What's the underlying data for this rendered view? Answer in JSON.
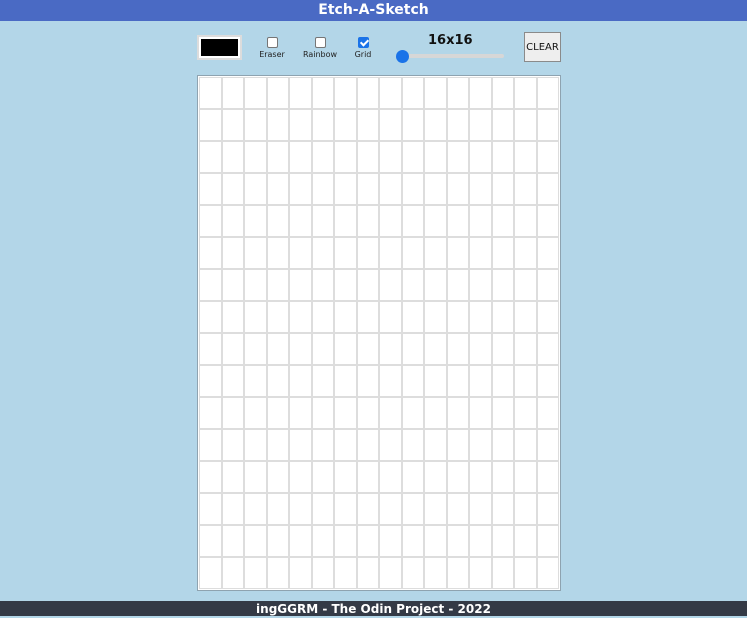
{
  "header": {
    "title": "Etch-A-Sketch"
  },
  "controls": {
    "color_value": "#000000",
    "eraser": {
      "label": "Eraser",
      "checked": false
    },
    "rainbow": {
      "label": "Rainbow",
      "checked": false
    },
    "grid": {
      "label": "Grid",
      "checked": true
    },
    "size_label": "16x16",
    "slider_value": 16,
    "slider_min": 16,
    "slider_max": 64,
    "clear_label": "CLEAR"
  },
  "canvas": {
    "rows": 16,
    "cols": 16,
    "cell_color": "#ffffff",
    "grid_line_color": "#dddddd"
  },
  "footer": {
    "text": "ingGGRM - The Odin Project - 2022"
  },
  "colors": {
    "header_bg": "#4a6ac4",
    "page_bg": "#b3d6e8",
    "footer_bg": "#343a46",
    "accent": "#1a73e8"
  }
}
